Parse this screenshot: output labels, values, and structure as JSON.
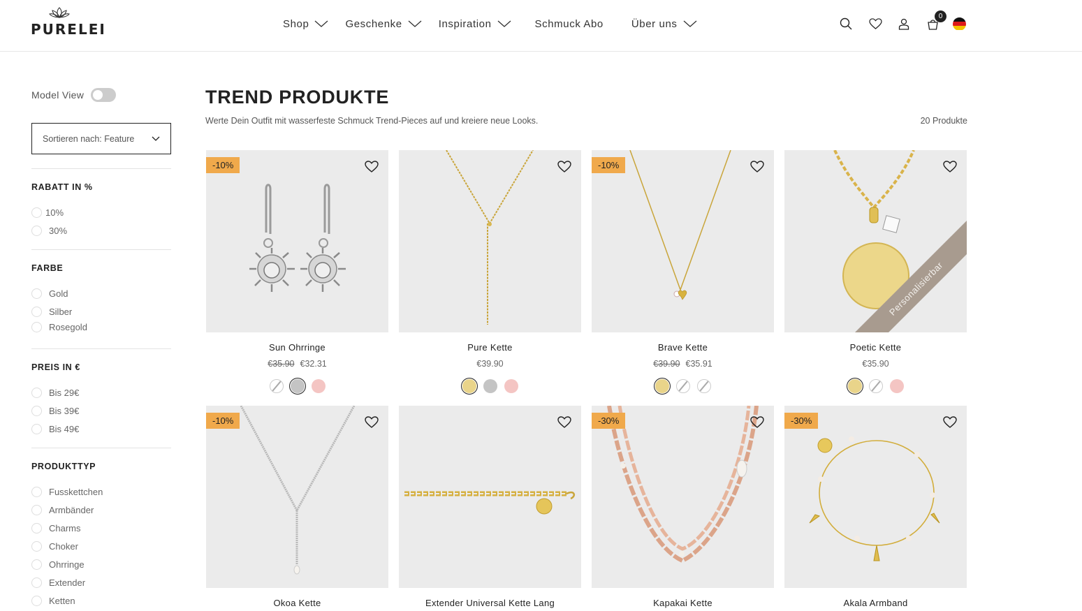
{
  "brand": {
    "name": "PURELEI"
  },
  "nav": {
    "items": [
      {
        "label": "Shop",
        "dropdown": true
      },
      {
        "label": "Geschenke",
        "dropdown": true
      },
      {
        "label": "Inspiration",
        "dropdown": true
      },
      {
        "label": "Schmuck Abo",
        "dropdown": false
      },
      {
        "label": "Über uns",
        "dropdown": true
      }
    ]
  },
  "header_icons": [
    "search-icon",
    "heart-icon",
    "user-icon",
    "cart-icon",
    "flag-de-icon"
  ],
  "cart": {
    "count": "0"
  },
  "sidebar": {
    "model_view_label": "Model View",
    "model_view_on": false,
    "sort_label": "Sortieren nach: Feature",
    "filters": [
      {
        "title": "RABATT IN %",
        "options": [
          "10%",
          "30%"
        ]
      },
      {
        "title": "FARBE",
        "options": [
          "Gold",
          "Silber",
          "Rosegold"
        ]
      },
      {
        "title": "PREIS IN €",
        "options": [
          "Bis 29€",
          "Bis 39€",
          "Bis 49€"
        ]
      },
      {
        "title": "PRODUKTTYP",
        "options": [
          "Fusskettchen",
          "Armbänder",
          "Charms",
          "Choker",
          "Ohrringe",
          "Extender",
          "Ketten"
        ]
      }
    ]
  },
  "main": {
    "title": "TREND PRODUKTE",
    "subtitle": "Werte Dein Outfit mit wasserfeste Schmuck Trend-Pieces auf und kreiere neue Looks.",
    "count": "20 Produkte"
  },
  "colors": {
    "gold": "#e9d48a",
    "silver": "#c4c4c4",
    "rose": "#f4c5c3",
    "badge": "#f0a94b",
    "banner": "#a89b8f"
  },
  "products": [
    {
      "name": "Sun Ohrringe",
      "badge": "-10%",
      "old_price": "€35.90",
      "price": "€32.31",
      "image": "sun-earrings"
    },
    {
      "name": "Pure Kette",
      "badge": "",
      "old_price": "",
      "price": "€39.90",
      "image": "pure-necklace"
    },
    {
      "name": "Brave Kette",
      "badge": "-10%",
      "old_price": "€39.90",
      "price": "€35.91",
      "image": "brave-necklace"
    },
    {
      "name": "Poetic Kette",
      "badge": "",
      "old_price": "",
      "price": "€35.90",
      "banner": "Personalisierbar",
      "image": "poetic-necklace"
    },
    {
      "name": "Okoa Kette",
      "badge": "-10%",
      "image": "okoa-necklace"
    },
    {
      "name": "Extender Universal Kette Lang",
      "badge": "",
      "image": "extender-chain"
    },
    {
      "name": "Kapakai Kette",
      "badge": "-30%",
      "image": "kapakai-necklace"
    },
    {
      "name": "Akala Armband",
      "badge": "-30%",
      "image": "akala-bracelet"
    }
  ]
}
